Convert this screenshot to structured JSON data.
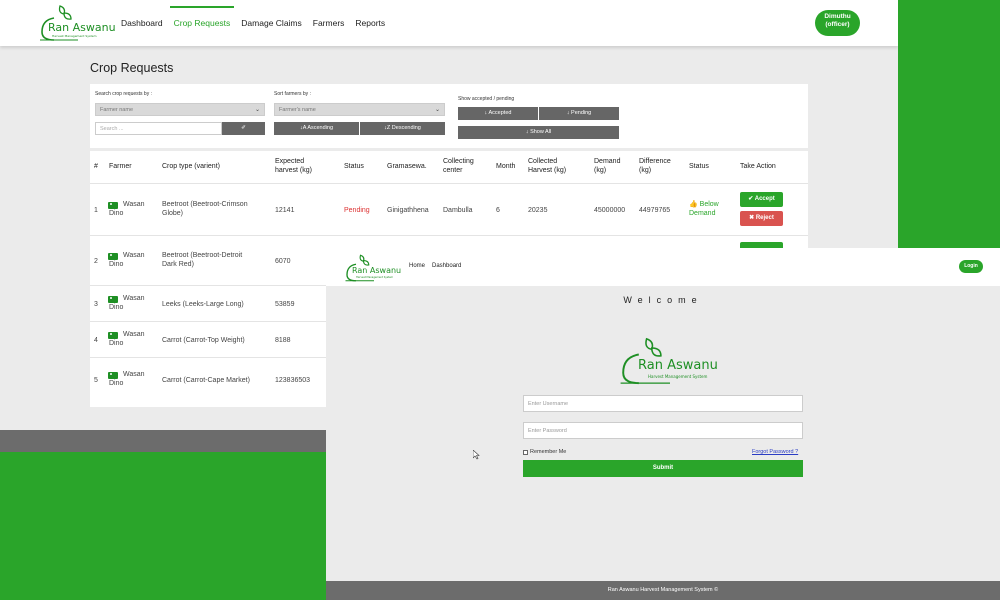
{
  "back": {
    "brand": {
      "name": "Ran Aswanu",
      "tagline": "Harvest Management System"
    },
    "nav": [
      "Dashboard",
      "Crop Requests",
      "Damage Claims",
      "Farmers",
      "Reports"
    ],
    "user": {
      "name": "Dimuthu",
      "role": "(officer)"
    },
    "page_title": "Crop Requests",
    "filters": {
      "search_label": "Search crop requests by :",
      "search_by_value": "Farmer name",
      "search_placeholder": "Search ...",
      "sort_label": "Sort farmers by :",
      "sort_value": "Farmer's name",
      "ascending": "Ascending",
      "descending": "Descending",
      "show_label": "Show accepted / pending",
      "accepted": "Accepted",
      "pending": "Pending",
      "show_all": "Show All"
    },
    "table": {
      "headers": {
        "num": "#",
        "farmer": "Farmer",
        "crop": "Crop type (varient)",
        "expected_1": "Expected",
        "expected_2": "harvest (kg)",
        "status": "Status",
        "gramasewa": "Gramasewa.",
        "collecting_1": "Collecting",
        "collecting_2": "center",
        "month": "Month",
        "collected_1": "Collected",
        "collected_2": "Harvest (kg)",
        "demand_1": "Demand",
        "demand_2": "(kg)",
        "difference_1": "Difference",
        "difference_2": "(kg)",
        "status2": "Status",
        "action": "Take Action"
      },
      "rows": [
        {
          "num": "1",
          "farmer_1": "Wasan",
          "farmer_2": "Dino",
          "crop_1": "Beetroot (Beetroot-Crimson",
          "crop_2": "Globe)",
          "expected": "12141",
          "status": "Pending",
          "gramasewa": "Ginigathhena",
          "center": "Dambulla",
          "month": "6",
          "collected": "20235",
          "demand": "45000000",
          "difference": "44979765",
          "status2_1": "Below",
          "status2_2": "Demand",
          "accept": "Accept",
          "reject": "Reject"
        },
        {
          "num": "2",
          "farmer_1": "Wasan",
          "farmer_2": "Dino",
          "crop_1": "Beetroot (Beetroot-Detroit",
          "crop_2": "Dark Red)",
          "expected": "6070"
        },
        {
          "num": "3",
          "farmer_1": "Wasan",
          "farmer_2": "Dino",
          "crop_1": "Leeks (Leeks-Large Long)",
          "crop_2": "",
          "expected": "53859"
        },
        {
          "num": "4",
          "farmer_1": "Wasan",
          "farmer_2": "Dino",
          "crop_1": "Carrot (Carrot-Top Weight)",
          "crop_2": "",
          "expected": "8188"
        },
        {
          "num": "5",
          "farmer_1": "Wasan",
          "farmer_2": "Dino",
          "crop_1": "Carrot (Carrot-Cape Market)",
          "crop_2": "",
          "expected": "123836503"
        }
      ]
    }
  },
  "front": {
    "brand": {
      "name": "Ran Aswanu",
      "tagline": "Harvest Management System"
    },
    "nav": [
      "Home",
      "Dashboard"
    ],
    "login_button": "Login",
    "welcome": "Welcome",
    "username_placeholder": "Enter Username",
    "password_placeholder": "Enter Password",
    "remember_me": "Remember Me",
    "forgot_password": "Forgot Password ?",
    "submit": "Submit",
    "footer": "Ran Aswanu Harvest Management System ©"
  },
  "colors": {
    "brand_green": "#2aa52a",
    "reject_red": "#d9534f",
    "pending_red": "#dd3333",
    "footer_gray": "#6c6c6c"
  }
}
